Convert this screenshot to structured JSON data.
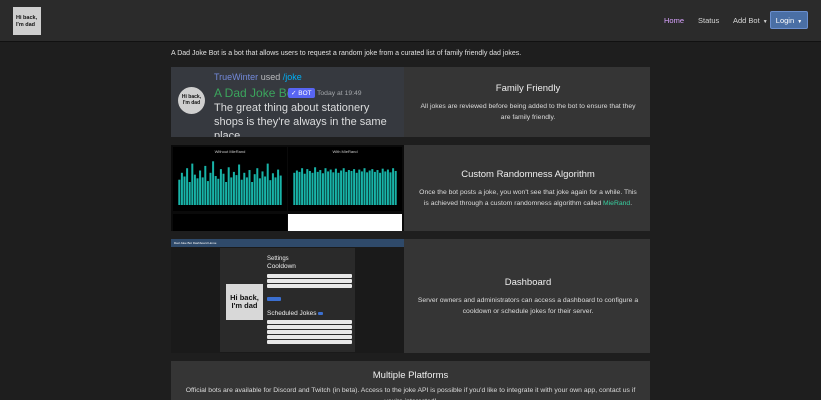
{
  "logo": {
    "line1": "Hi back,",
    "line2": "I'm dad"
  },
  "nav": {
    "home": "Home",
    "status": "Status",
    "add_bot": "Add Bot",
    "login": "Login",
    "caret": "▼"
  },
  "intro": "A Dad Joke Bot is a bot that allows users to request a random joke from a curated list of family friendly dad jokes.",
  "features": [
    {
      "title": "Family Friendly",
      "text": "All jokes are reviewed before being added to the bot to ensure that they are family friendly."
    },
    {
      "title": "Custom Randomness Algorithm",
      "text_before": "Once the bot posts a joke, you won't see that joke again for a while. This is achieved through a custom randomness algorithm called ",
      "link": "MieRand",
      "text_after": "."
    },
    {
      "title": "Dashboard",
      "text": "Server owners and administrators can access a dashboard to configure a cooldown or schedule jokes for their server."
    },
    {
      "title": "Multiple Platforms",
      "text": "Official bots are available for Discord and Twitch (in beta). Access to the joke API is possible if you'd like to integrate it with your own app, contact us if you're interested!"
    }
  ],
  "discord_preview": {
    "avatar_line1": "Hi back,",
    "avatar_line2": "I'm dad",
    "user": "TrueWinter",
    "used": "used",
    "command": "/joke",
    "bot_name": "A Dad Joke Bot",
    "badge": "✓ BOT",
    "timestamp": "Today at 19:49",
    "joke": "The great thing about stationery shops is they're always in the same place."
  },
  "histograms": {
    "left_title": "Without MieRand",
    "right_title": "With MieRand",
    "bar_color": "#18b4a8",
    "left_values": [
      0.55,
      0.7,
      0.62,
      0.8,
      0.5,
      0.9,
      0.66,
      0.58,
      0.75,
      0.6,
      0.85,
      0.52,
      0.7,
      0.95,
      0.63,
      0.57,
      0.78,
      0.68,
      0.5,
      0.82,
      0.6,
      0.72,
      0.65,
      0.88,
      0.55,
      0.7,
      0.6,
      0.76,
      0.5,
      0.67,
      0.8,
      0.58,
      0.73,
      0.62,
      0.9,
      0.54,
      0.69,
      0.6,
      0.77,
      0.64
    ],
    "right_values": [
      0.7,
      0.75,
      0.72,
      0.8,
      0.68,
      0.78,
      0.74,
      0.7,
      0.82,
      0.72,
      0.76,
      0.69,
      0.8,
      0.73,
      0.77,
      0.71,
      0.79,
      0.7,
      0.75,
      0.8,
      0.72,
      0.76,
      0.74,
      0.78,
      0.7,
      0.77,
      0.73,
      0.8,
      0.71,
      0.75,
      0.78,
      0.72,
      0.76,
      0.7,
      0.79,
      0.73,
      0.77,
      0.71,
      0.8,
      0.74
    ]
  },
  "dashboard": {
    "topbar": "Dad Joke Bot Dashboard   Home",
    "logo_line1": "Hi back,",
    "logo_line2": "I'm dad",
    "settings": "Settings",
    "cooldown": "Cooldown",
    "scheduled": "Scheduled Jokes"
  }
}
